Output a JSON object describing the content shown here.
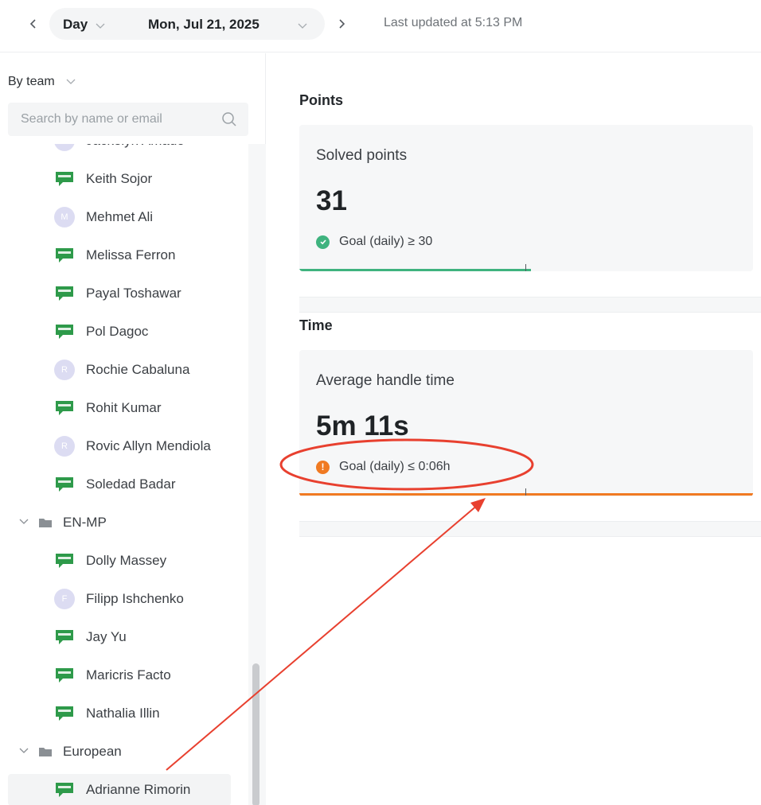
{
  "header": {
    "period": "Day",
    "date": "Mon, Jul 21, 2025",
    "last_updated": "Last updated at 5:13 PM"
  },
  "sidebar": {
    "group_by": "By team",
    "search_placeholder": "Search by name or email",
    "rows": [
      {
        "type": "agent",
        "name": "Jackelyn Amado",
        "avatar": "letter",
        "initial": "J",
        "partial": true
      },
      {
        "type": "agent",
        "name": "Keith Sojor",
        "avatar": "chat"
      },
      {
        "type": "agent",
        "name": "Mehmet Ali",
        "avatar": "letter",
        "initial": "M"
      },
      {
        "type": "agent",
        "name": "Melissa Ferron",
        "avatar": "chat"
      },
      {
        "type": "agent",
        "name": "Payal Toshawar",
        "avatar": "chat"
      },
      {
        "type": "agent",
        "name": "Pol Dagoc",
        "avatar": "chat"
      },
      {
        "type": "agent",
        "name": "Rochie Cabaluna",
        "avatar": "letter",
        "initial": "R"
      },
      {
        "type": "agent",
        "name": "Rohit Kumar",
        "avatar": "chat"
      },
      {
        "type": "agent",
        "name": "Rovic Allyn Mendiola",
        "avatar": "letter",
        "initial": "R"
      },
      {
        "type": "agent",
        "name": "Soledad Badar",
        "avatar": "chat"
      },
      {
        "type": "team",
        "name": "EN-MP"
      },
      {
        "type": "agent",
        "name": "Dolly Massey",
        "avatar": "chat"
      },
      {
        "type": "agent",
        "name": "Filipp Ishchenko",
        "avatar": "letter",
        "initial": "F"
      },
      {
        "type": "agent",
        "name": "Jay Yu",
        "avatar": "chat"
      },
      {
        "type": "agent",
        "name": "Maricris Facto",
        "avatar": "chat"
      },
      {
        "type": "agent",
        "name": "Nathalia Illin",
        "avatar": "chat"
      },
      {
        "type": "team",
        "name": "European"
      },
      {
        "type": "agent",
        "name": "Adrianne Rimorin",
        "avatar": "chat",
        "selected": true
      }
    ]
  },
  "main": {
    "points": {
      "section_title": "Points",
      "label": "Solved points",
      "value": "31",
      "goal_text": "Goal (daily) ≥ 30",
      "goal_status": "met",
      "progress": 0.51
    },
    "time": {
      "section_title": "Time",
      "label": "Average handle time",
      "value": "5m 11s",
      "goal_text": "Goal (daily) ≤ 0:06h",
      "goal_status": "warning",
      "progress": 1.0
    }
  },
  "colors": {
    "green": "#3fb37f",
    "orange": "#f07a22",
    "chat_icon": "#2e9a4a",
    "annotation": "#e8402f"
  },
  "icons": {
    "chat_avatar": "chat-bubble-icon",
    "folder": "folder-icon",
    "search": "search-icon"
  }
}
